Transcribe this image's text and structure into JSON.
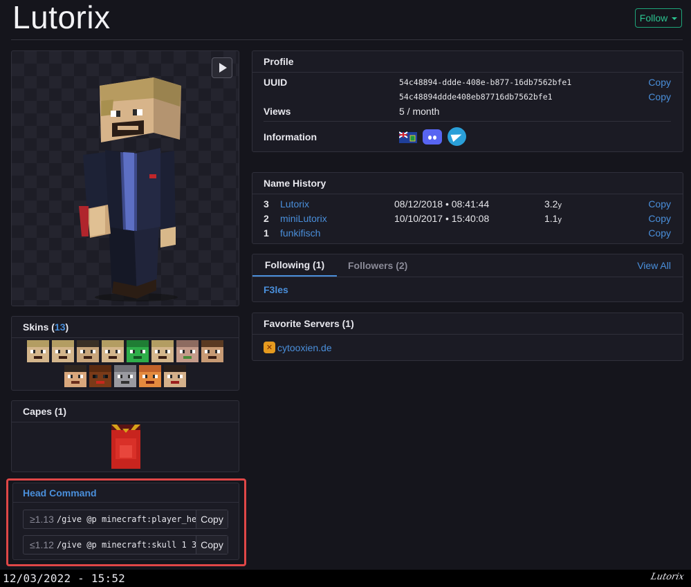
{
  "header": {
    "player_name": "Lutorix",
    "follow_label": "Follow"
  },
  "skins": {
    "title": "Skins (",
    "count": "13",
    "title_suffix": ")"
  },
  "capes": {
    "title": "Capes (1)"
  },
  "head_command": {
    "title": "Head Command",
    "commands": [
      {
        "version": "≥1.13",
        "command": "/give @p minecraft:player_head",
        "copy_label": "Copy"
      },
      {
        "version": "≤1.12",
        "command": "/give @p minecraft:skull 1 3",
        "copy_label": "Copy"
      }
    ]
  },
  "profile": {
    "title": "Profile",
    "uuid_label": "UUID",
    "uuid_dashed": "54c48894-ddde-408e-b877-16db7562bfe1",
    "uuid_plain": "54c48894ddde408eb87716db7562bfe1",
    "copy_label": "Copy",
    "views_label": "Views",
    "views_value": "5 / month",
    "information_label": "Information",
    "info_icons": [
      "british-virgin-islands-flag-icon",
      "discord-icon",
      "telegram-icon"
    ]
  },
  "name_history": {
    "title": "Name History",
    "rows": [
      {
        "num": "3",
        "name": "Lutorix",
        "date": "08/12/2018 • 08:41:44",
        "ago": "3.2",
        "unit": "y",
        "copy": "Copy"
      },
      {
        "num": "2",
        "name": "miniLutorix",
        "date": "10/10/2017 • 15:40:08",
        "ago": "1.1",
        "unit": "y",
        "copy": "Copy"
      },
      {
        "num": "1",
        "name": "funkifisch",
        "date": "",
        "ago": "",
        "unit": "",
        "copy": "Copy"
      }
    ]
  },
  "social": {
    "tab_following": "Following (1)",
    "tab_followers": "Followers (2)",
    "view_all": "View All",
    "following_list": [
      "F3les"
    ]
  },
  "favorite_servers": {
    "title": "Favorite Servers (1)",
    "servers": [
      "cytooxien.de"
    ]
  },
  "footer": {
    "timestamp": "12/03/2022 - 15:52",
    "logo_text": "Lutorix"
  },
  "colors": {
    "accent": "#4a8fdb",
    "follow": "#2cc591",
    "highlight": "#e04747",
    "background": "#15151c",
    "card": "#1b1b24"
  }
}
